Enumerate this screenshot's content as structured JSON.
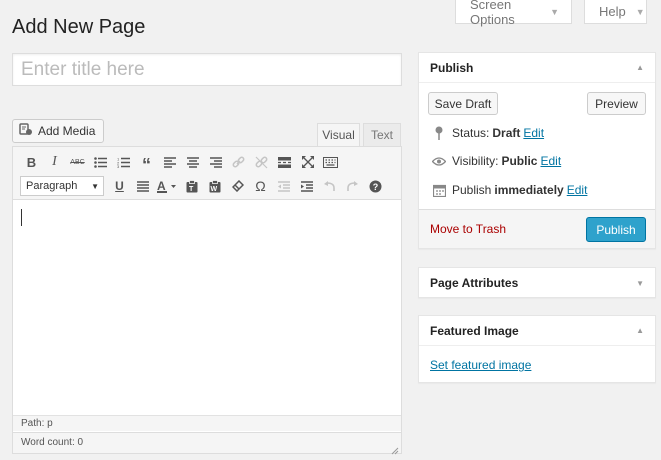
{
  "header": {
    "screen_options": "Screen Options",
    "help": "Help",
    "page_title": "Add New Page"
  },
  "title_field": {
    "placeholder": "Enter title here",
    "value": ""
  },
  "editor": {
    "add_media": "Add Media",
    "tabs": {
      "visual": "Visual",
      "text": "Text"
    },
    "format_select": "Paragraph",
    "path": "Path: p",
    "word_count": "Word count: 0"
  },
  "publish_box": {
    "title": "Publish",
    "save_draft": "Save Draft",
    "preview": "Preview",
    "status_label": "Status:",
    "status_value": "Draft",
    "visibility_label": "Visibility:",
    "visibility_value": "Public",
    "publish_label": "Publish",
    "publish_value": "immediately",
    "edit": "Edit",
    "move_to_trash": "Move to Trash",
    "publish_button": "Publish"
  },
  "page_attributes": {
    "title": "Page Attributes"
  },
  "featured_image": {
    "title": "Featured Image",
    "link": "Set featured image"
  },
  "colors": {
    "accent": "#2ea2cc",
    "link": "#0074a2",
    "trash": "#aa0000",
    "background": "#f1f1f1"
  }
}
